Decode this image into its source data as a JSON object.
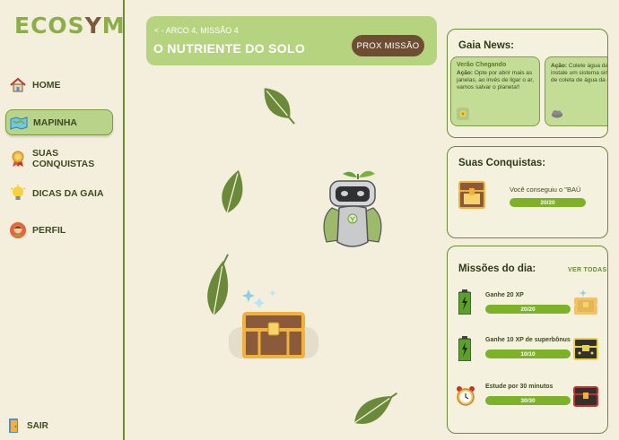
{
  "app": {
    "logo_pre": "ECOS",
    "logo_y": "Y",
    "logo_post": "M"
  },
  "sidebar": {
    "items": [
      {
        "label": "HOME",
        "icon": "home-icon"
      },
      {
        "label": "MAPINHA",
        "icon": "map-icon",
        "active": true
      },
      {
        "label": "SUAS CONQUISTAS",
        "icon": "medal-icon"
      },
      {
        "label": "DICAS DA GAIA",
        "icon": "lightbulb-icon"
      },
      {
        "label": "PERFIL",
        "icon": "avatar-icon"
      }
    ],
    "exit_label": "SAIR"
  },
  "header": {
    "crumb": "< - ARCO 4, MISSÃO 4",
    "title": "O NUTRIENTE DO SOLO",
    "next_label": "PROX MISSÃO"
  },
  "news": {
    "title": "Gaia News:",
    "cards": [
      {
        "headline": "Verão Chegando",
        "action_label": "Ação:",
        "text": "Opte por abrir mais as janelas, ao invés de ligar o ar, vamos salvar o planeta!!",
        "icon": "sun-flower-icon"
      },
      {
        "headline": "",
        "action_label": "Ação:",
        "text": "Colete água da chuva, instale um sistema simples de coleta de água da chuva.",
        "icon": "cloud-icon"
      }
    ]
  },
  "achievements": {
    "title": "Suas Conquistas:",
    "text": "Você conseguiu o \"BAÚ",
    "progress_text": "20/20",
    "progress": 1.0
  },
  "missions": {
    "title": "Missões do dia:",
    "see_all": "VER TODAS",
    "items": [
      {
        "label": "Ganhe 20 XP",
        "progress_text": "20/20",
        "progress": 1.0
      },
      {
        "label": "Ganhe 10 XP de superbônus",
        "progress_text": "10/10",
        "progress": 1.0
      },
      {
        "label": "Estude por 30 minutos",
        "progress_text": "30/30",
        "progress": 1.0
      }
    ]
  },
  "colors": {
    "accent": "#b6d37f",
    "brand_green": "#6b8a35",
    "button_brown": "#6e4e33",
    "progress_green": "#7db228",
    "leaf": "#6a8a3a"
  }
}
